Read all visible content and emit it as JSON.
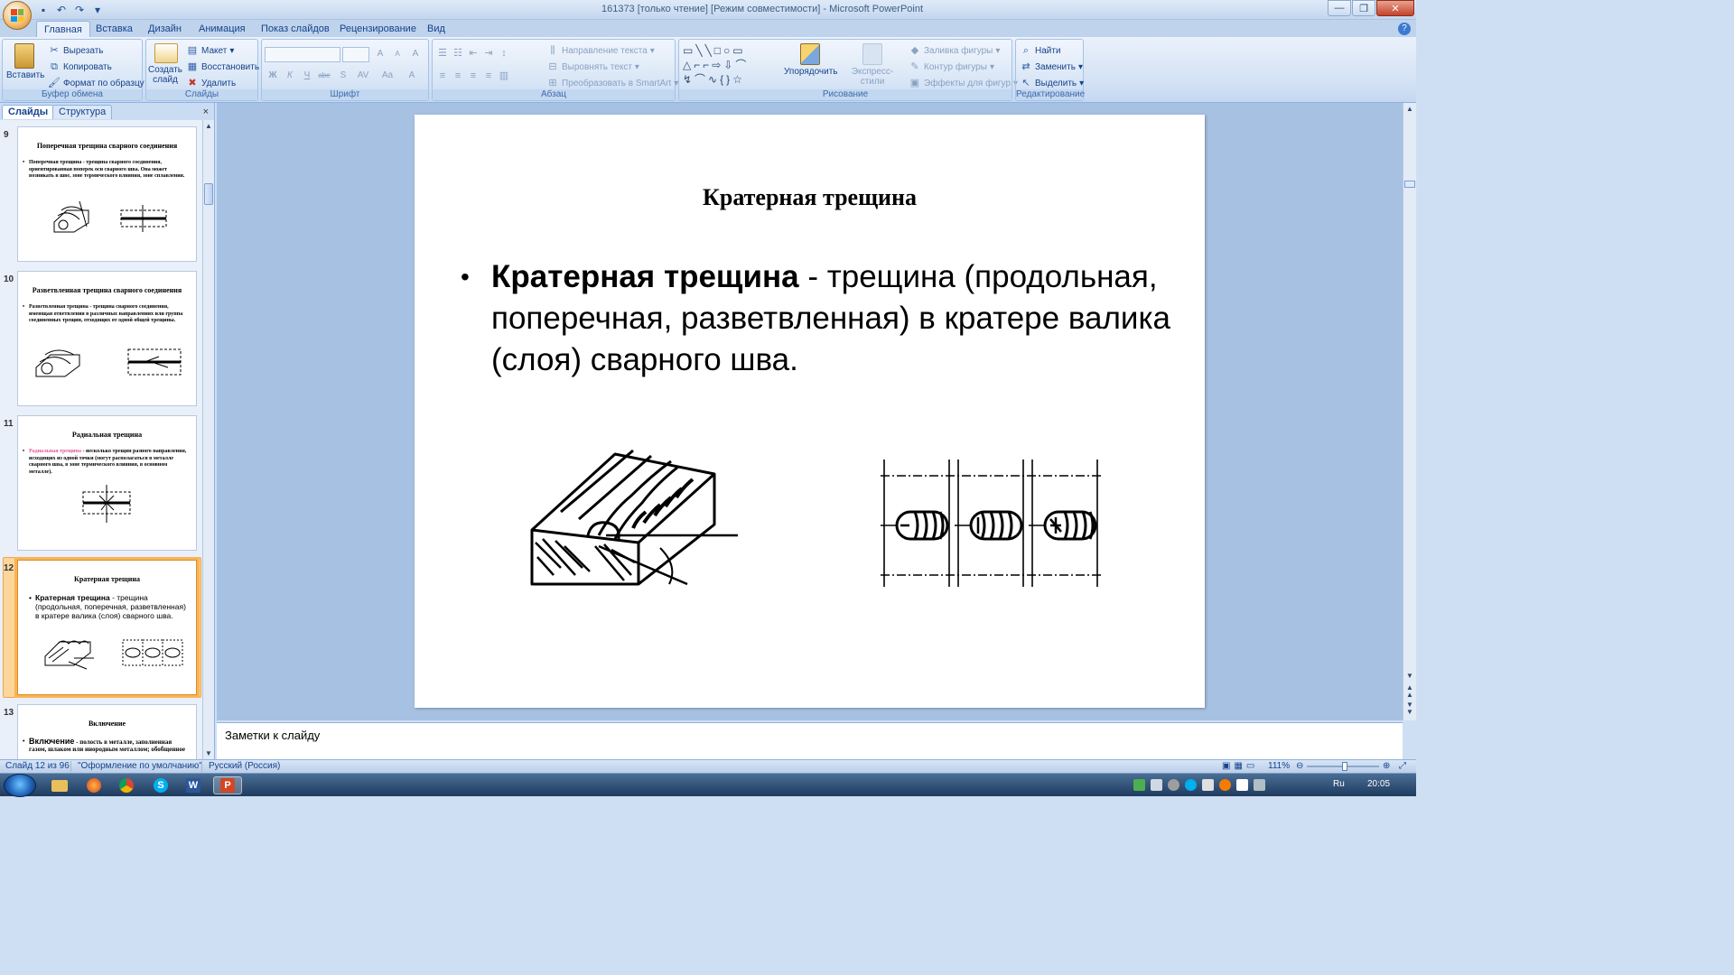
{
  "window": {
    "title": "161373 [только чтение] [Режим совместимости] - Microsoft PowerPoint",
    "controls": [
      "—",
      "❐",
      "✕"
    ]
  },
  "ribbon_tabs": [
    "Главная",
    "Вставка",
    "Дизайн",
    "Анимация",
    "Показ слайдов",
    "Рецензирование",
    "Вид"
  ],
  "ribbon": {
    "clipboard": {
      "label": "Буфер обмена",
      "paste": "Вставить",
      "cut": "Вырезать",
      "copy": "Копировать",
      "format_painter": "Формат по образцу"
    },
    "slides": {
      "label": "Слайды",
      "new_slide": "Создать слайд",
      "layout": "Макет",
      "reset": "Восстановить",
      "delete": "Удалить"
    },
    "font": {
      "label": "Шрифт",
      "bold": "Ж",
      "italic": "К",
      "underline": "Ч",
      "strike": "abe",
      "shadow": "S",
      "spacing": "AV",
      "case": "Aa",
      "grow": "A",
      "shrink": "A",
      "clear": "A",
      "color": "A"
    },
    "paragraph": {
      "label": "Абзац",
      "text_direction": "Направление текста",
      "align_text": "Выровнять текст",
      "smartart": "Преобразовать в SmartArt"
    },
    "drawing": {
      "label": "Рисование",
      "arrange": "Упорядочить",
      "quick_styles": "Экспресс-стили",
      "shape_fill": "Заливка фигуры",
      "shape_outline": "Контур фигуры",
      "shape_effects": "Эффекты для фигур"
    },
    "editing": {
      "label": "Редактирование",
      "find": "Найти",
      "replace": "Заменить",
      "select": "Выделить"
    }
  },
  "panel": {
    "tab_slides": "Слайды",
    "tab_outline": "Структура",
    "close": "×",
    "thumbnails": [
      {
        "num": "9",
        "title": "Поперечная трещина  сварного соединения",
        "body": "Поперечная трещина - трещина сварного соединения, ориентированная поперек оси сварного шва. Она может возникать в шве, зоне термического влияния, зоне сплавления."
      },
      {
        "num": "10",
        "title": "Разветвленная трещина  сварного соединения",
        "body": "Разветвленная трещина - трещина сварного соединения, имеющая ответвления в различных направлениях или группа соединенных трещин, отходящих от одной общей трещины."
      },
      {
        "num": "11",
        "title": "Радиальная трещина",
        "body_highlight": "Радиальная трещина",
        "body": " - несколько трещин разного направления, исходящих из одной точки (могут располагаться в металле сварного шва, в зоне термического влияния, в основном металле)."
      },
      {
        "num": "12",
        "title": "Кратерная трещина",
        "body_bold": "Кратерная трещина",
        "body": " - трещина (продольная, поперечная, разветвленная) в кратере валика (слоя) сварного шва."
      },
      {
        "num": "13",
        "title": "Включение",
        "body_bold": "Включение",
        "body": " - полость в металле, заполненная газом, шлаком или инородным металлом; обобщенное"
      }
    ]
  },
  "slide": {
    "title": "Кратерная трещина",
    "term": "Кратерная трещина",
    "definition": " - трещина (продольная, поперечная, разветвленная) в кратере валика (слоя) сварного шва."
  },
  "notes_placeholder": "Заметки к слайду",
  "status": {
    "slide_counter": "Слайд 12 из 96",
    "theme": "\"Оформление по умолчанию\"",
    "language": "Русский (Россия)",
    "zoom": "111%"
  },
  "taskbar": {
    "lang": "Ru",
    "time": "20:05"
  },
  "colors": {
    "ribbon_bg": "#d3e2f5",
    "selection": "#f8b457",
    "accent_text": "#15428b",
    "highlight_pink": "#e35b9b"
  }
}
